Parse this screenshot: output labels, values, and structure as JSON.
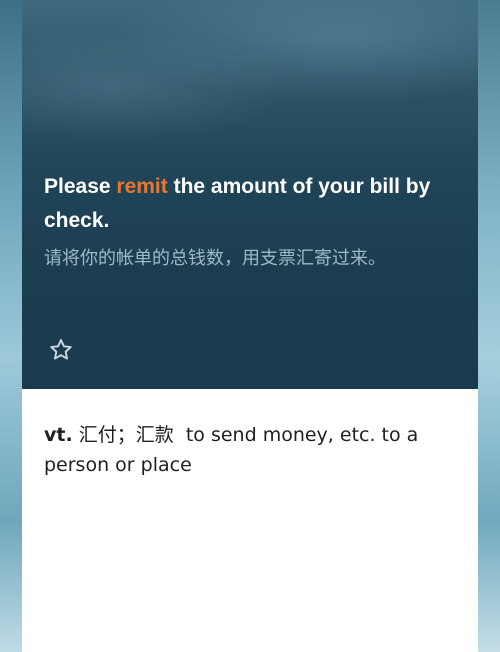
{
  "card": {
    "sentence": {
      "before": "Please ",
      "keyword": "remit",
      "after": " the amount of your bill by check."
    },
    "translation": "请将你的帐单的总钱数，用支票汇寄过来。",
    "favorite_icon": "star-outline-icon",
    "definition": {
      "pos": "vt.",
      "chinese": "汇付；汇款",
      "english": "to send money, etc. to a person or place"
    }
  },
  "colors": {
    "keyword": "#e8782e",
    "hero_background": "#1b3d50",
    "translation_text": "#9fb8c6"
  }
}
